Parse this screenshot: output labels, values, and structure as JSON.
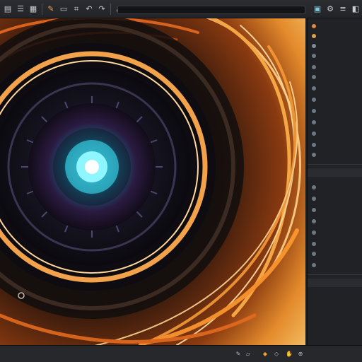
{
  "toolbar": {
    "icons": [
      "file-icon",
      "grid-icon",
      "layers-icon",
      "brush-icon",
      "select-icon",
      "crop-icon",
      "undo-icon",
      "redo-icon",
      "transform-icon",
      "view-icon",
      "lock-icon",
      "user-icon",
      "settings-icon"
    ],
    "path_value": ""
  },
  "panel": {
    "sections": [
      {
        "header": ""
      },
      {
        "header": ""
      }
    ],
    "rows_top": [
      {
        "label": "",
        "color": "#e08a3c"
      },
      {
        "label": "",
        "color": "#d9a24a"
      },
      {
        "label": "",
        "color": "#7f8a96"
      },
      {
        "label": "",
        "color": "#6f7884"
      },
      {
        "label": "",
        "color": "#6f7884"
      },
      {
        "label": "",
        "color": "#6f7884"
      },
      {
        "label": "",
        "color": "#6f7884"
      },
      {
        "label": "",
        "color": "#6f7884"
      },
      {
        "label": "",
        "color": "#6f7884"
      },
      {
        "label": "",
        "color": "#6f7884"
      },
      {
        "label": "",
        "color": "#6f7884"
      },
      {
        "label": "",
        "color": "#6f7884"
      },
      {
        "label": "",
        "color": "#6f7884"
      }
    ],
    "rows_bottom": [
      {
        "label": "",
        "color": "#6f7884"
      },
      {
        "label": "",
        "color": "#6f7884"
      },
      {
        "label": "",
        "color": "#6f7884"
      },
      {
        "label": "",
        "color": "#6f7884"
      },
      {
        "label": "",
        "color": "#6f7884"
      },
      {
        "label": "",
        "color": "#6f7884"
      },
      {
        "label": "",
        "color": "#6f7884"
      },
      {
        "label": "",
        "color": "#6f7884"
      }
    ]
  },
  "statusbar": {
    "icons": [
      "brush-icon",
      "eraser-icon",
      "fill-icon",
      "picker-icon",
      "hand-icon",
      "zoom-icon"
    ],
    "zoom_text": ""
  },
  "colors": {
    "accent_orange": "#f29a3a",
    "glow_cyan": "#5fe7f0",
    "panel_bg": "#202226"
  }
}
